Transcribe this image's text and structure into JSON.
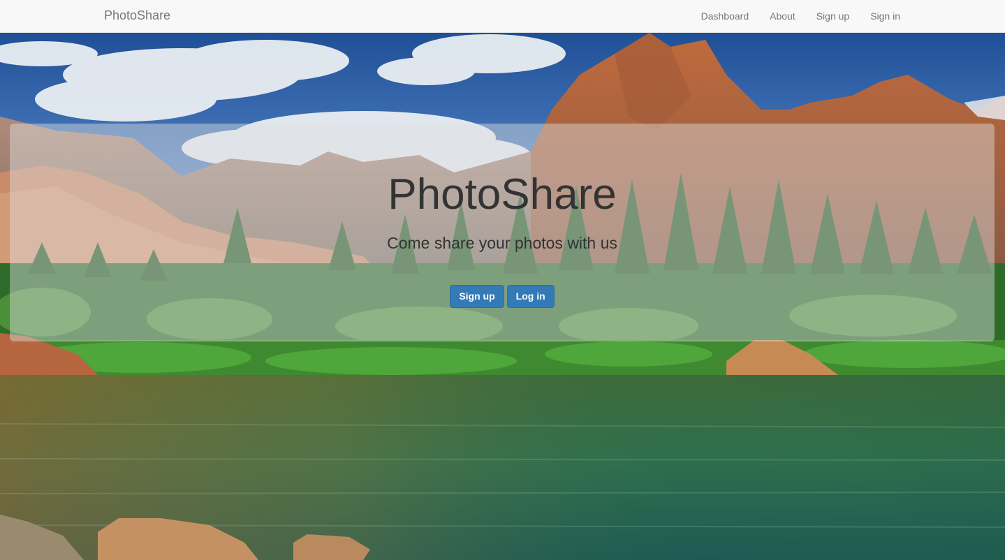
{
  "navbar": {
    "brand": "PhotoShare",
    "links": [
      "Dashboard",
      "About",
      "Sign up",
      "Sign in"
    ]
  },
  "hero": {
    "title": "PhotoShare",
    "subtitle": "Come share your photos with us",
    "buttons": [
      "Sign up",
      "Log in"
    ]
  },
  "colors": {
    "primary_button": "#337ab7",
    "navbar_bg": "#f8f8f8",
    "nav_text": "#777777",
    "hero_text": "#333333"
  }
}
